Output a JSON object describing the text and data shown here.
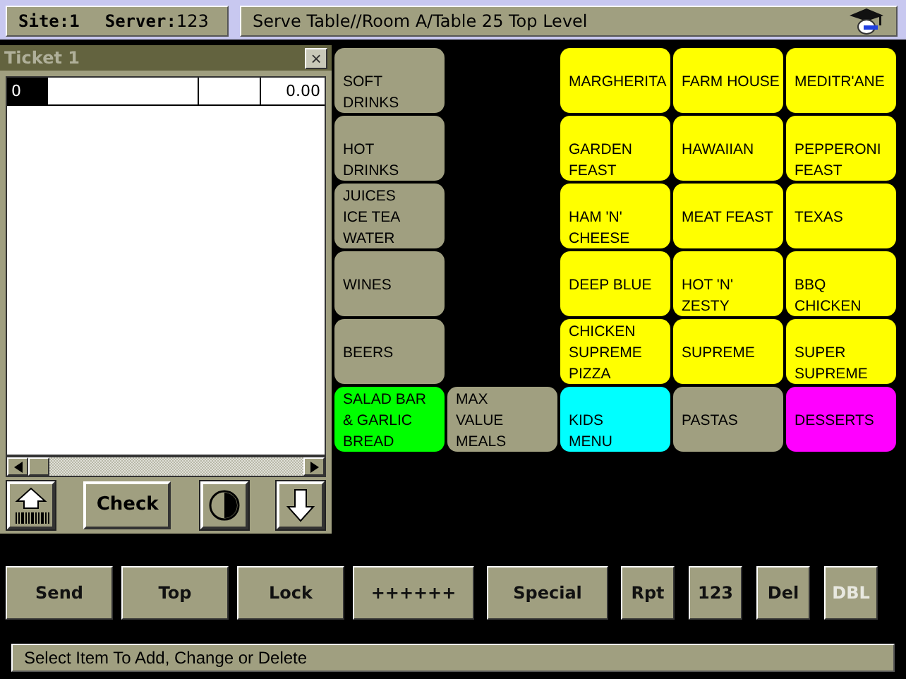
{
  "header": {
    "site": "Site:1",
    "server_label": "Server:",
    "server": "123",
    "location": "Serve Table//Room A/Table 25  Top Level"
  },
  "ticket": {
    "title": "Ticket 1",
    "close": "×",
    "line": {
      "qty": "0",
      "amount": "0.00"
    },
    "check_button": "Check"
  },
  "menu_grid": [
    [
      {
        "kind": "button",
        "lines": [
          "SOFT",
          "DRINKS"
        ],
        "color": "#a09f80"
      },
      {
        "kind": "blank"
      },
      {
        "kind": "button",
        "lines": [
          "MARGHERITA"
        ],
        "color": "#ffff00"
      },
      {
        "kind": "button",
        "lines": [
          "FARM HOUSE"
        ],
        "color": "#ffff00"
      },
      {
        "kind": "button",
        "lines": [
          "MEDITR'ANE"
        ],
        "color": "#ffff00"
      }
    ],
    [
      {
        "kind": "button",
        "lines": [
          "HOT",
          "DRINKS"
        ],
        "color": "#a09f80"
      },
      {
        "kind": "blank"
      },
      {
        "kind": "button",
        "lines": [
          "GARDEN",
          "FEAST"
        ],
        "color": "#ffff00"
      },
      {
        "kind": "button",
        "lines": [
          "HAWAIIAN"
        ],
        "color": "#ffff00"
      },
      {
        "kind": "button",
        "lines": [
          "PEPPERONI",
          "FEAST"
        ],
        "color": "#ffff00"
      }
    ],
    [
      {
        "kind": "button",
        "lines": [
          "JUICES",
          "ICE TEA",
          "WATER"
        ],
        "color": "#a09f80"
      },
      {
        "kind": "blank"
      },
      {
        "kind": "button",
        "lines": [
          "HAM 'N'",
          "CHEESE"
        ],
        "color": "#ffff00"
      },
      {
        "kind": "button",
        "lines": [
          "MEAT FEAST"
        ],
        "color": "#ffff00"
      },
      {
        "kind": "button",
        "lines": [
          "TEXAS"
        ],
        "color": "#ffff00"
      }
    ],
    [
      {
        "kind": "button",
        "lines": [
          "WINES"
        ],
        "color": "#a09f80"
      },
      {
        "kind": "blank"
      },
      {
        "kind": "button",
        "lines": [
          "DEEP BLUE"
        ],
        "color": "#ffff00"
      },
      {
        "kind": "button",
        "lines": [
          "HOT 'N'",
          "ZESTY"
        ],
        "color": "#ffff00"
      },
      {
        "kind": "button",
        "lines": [
          "BBQ",
          "CHICKEN"
        ],
        "color": "#ffff00"
      }
    ],
    [
      {
        "kind": "button",
        "lines": [
          "BEERS"
        ],
        "color": "#a09f80"
      },
      {
        "kind": "blank"
      },
      {
        "kind": "button",
        "lines": [
          "CHICKEN",
          "SUPREME",
          "PIZZA"
        ],
        "color": "#ffff00"
      },
      {
        "kind": "button",
        "lines": [
          "SUPREME"
        ],
        "color": "#ffff00"
      },
      {
        "kind": "button",
        "lines": [
          "SUPER",
          "SUPREME"
        ],
        "color": "#ffff00"
      }
    ],
    [
      {
        "kind": "button",
        "lines": [
          "SALAD BAR",
          "& GARLIC",
          "BREAD"
        ],
        "color": "#00ff00"
      },
      {
        "kind": "button",
        "lines": [
          "MAX",
          "VALUE",
          "MEALS"
        ],
        "color": "#a09f80"
      },
      {
        "kind": "button",
        "lines": [
          "KIDS",
          "MENU"
        ],
        "color": "#00ffff"
      },
      {
        "kind": "button",
        "lines": [
          "PASTAS"
        ],
        "color": "#a09f80"
      },
      {
        "kind": "button",
        "lines": [
          "DESSERTS"
        ],
        "color": "#ff00ff"
      }
    ]
  ],
  "actions": [
    {
      "label": "Send",
      "disabled": false
    },
    {
      "label": "Top",
      "disabled": false
    },
    {
      "label": "Lock",
      "disabled": false
    },
    {
      "label": "++++++",
      "disabled": false
    },
    {
      "label": "Special",
      "disabled": false
    },
    {
      "label": "Rpt",
      "disabled": false
    },
    {
      "label": "123",
      "disabled": false
    },
    {
      "label": "Del",
      "disabled": false
    },
    {
      "label": "DBL",
      "disabled": true
    }
  ],
  "status_bar": "Select Item To Add, Change or Delete"
}
